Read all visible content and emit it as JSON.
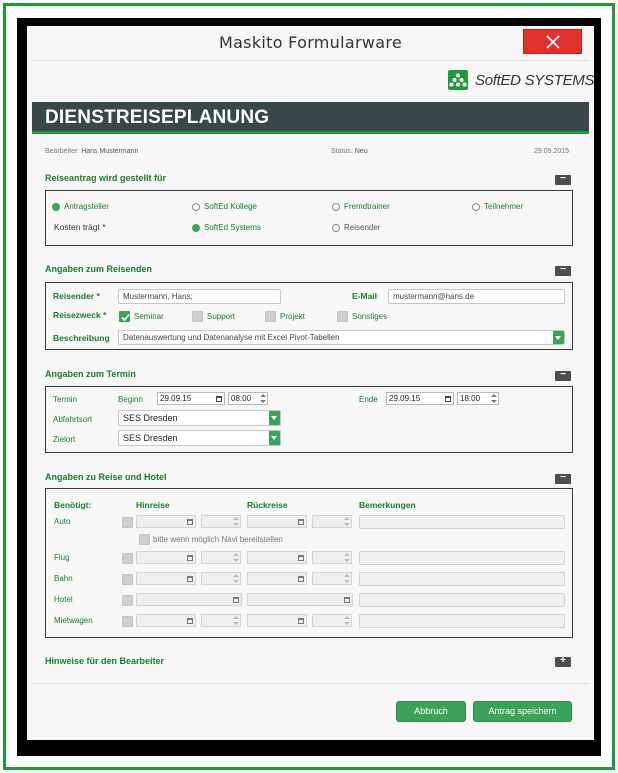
{
  "window": {
    "title": "Maskito Formularware"
  },
  "brand": {
    "logo_text": "SoftED SYSTEMS"
  },
  "header": {
    "banner": "DIENSTREISEPLANUNG"
  },
  "meta": {
    "bearbeiter_label": "Bearbeiter:",
    "bearbeiter_value": "Hans Mustermann",
    "status_label": "Status:",
    "status_value": "Neu",
    "date": "29.09.2015"
  },
  "section1": {
    "title": "Reiseantrag wird gestellt für",
    "toggle": "−",
    "options": [
      "Antragsteller",
      "SoftEd Kollege",
      "Fremdtrainer",
      "Teilnehmer"
    ],
    "kosten_label": "Kosten trägt *",
    "kosten_options": [
      "SoftEd Systems",
      "Reisender"
    ]
  },
  "section2": {
    "title": "Angaben zum Reisenden",
    "toggle": "−",
    "reisender_label": "Reisender *",
    "reisender_value": "Mustermann, Hans;",
    "email_label": "E-Mail",
    "email_value": "mustermann@hans.de",
    "zweck_label": "Reisezweck *",
    "zweck_options": [
      "Seminar",
      "Support",
      "Projekt",
      "Sonstiges"
    ],
    "beschreibung_label": "Beschreibung",
    "beschreibung_value": "Datenauswertung und Datenanalyse mit Excel Pivot-Tabellen"
  },
  "section3": {
    "title": "Angaben zum Termin",
    "toggle": "−",
    "termin_label": "Termin",
    "beginn_label": "Beginn",
    "beginn_date": "29.09.15",
    "beginn_time": "08:00",
    "ende_label": "Ende",
    "ende_date": "29.09.15",
    "ende_time": "18:00",
    "abfahrt_label": "Abfahrtsort",
    "abfahrt_value": "SES Dresden",
    "ziel_label": "Zielort",
    "ziel_value": "SES Dresden"
  },
  "section4": {
    "title": "Angaben zu Reise und Hotel",
    "toggle": "−",
    "benoetigt": "Benötigt:",
    "hinreise": "Hinreise",
    "rueckreise": "Rückreise",
    "bemerkungen": "Bemerkungen",
    "rows": [
      "Auto",
      "Flug",
      "Bahn",
      "Hotel",
      "Mietwagen"
    ],
    "navi_label": "bitte wenn möglich Navi bereitstellen"
  },
  "section5": {
    "title": "Hinweise für den Bearbeiter",
    "toggle": "+"
  },
  "buttons": {
    "cancel": "Abbruch",
    "save": "Antrag speichern"
  }
}
